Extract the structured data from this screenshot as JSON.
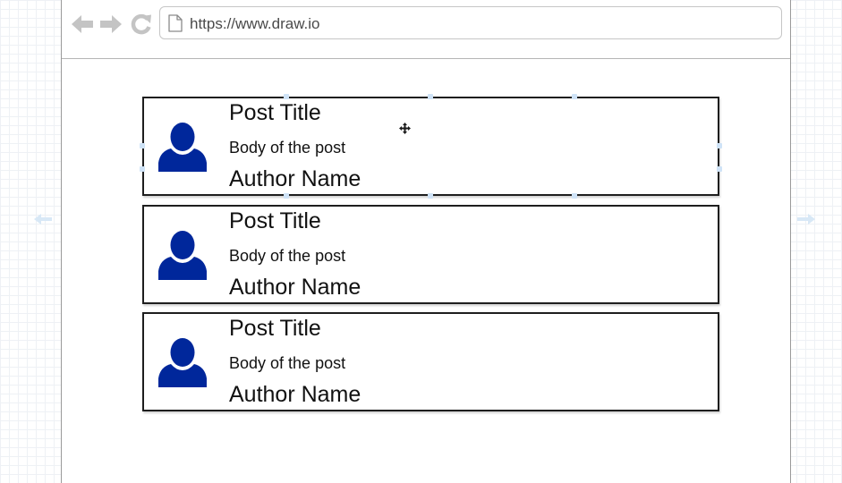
{
  "browser": {
    "url": "https://www.draw.io",
    "icons": {
      "back": "back-arrow-icon",
      "forward": "forward-arrow-icon",
      "reload": "reload-icon",
      "page": "page-icon"
    }
  },
  "posts": [
    {
      "title": "Post Title",
      "body": "Body of the post",
      "author": "Author Name",
      "icon": "user-avatar-icon"
    },
    {
      "title": "Post Title",
      "body": "Body of the post",
      "author": "Author Name",
      "icon": "user-avatar-icon"
    },
    {
      "title": "Post Title",
      "body": "Body of the post",
      "author": "Author Name",
      "icon": "user-avatar-icon"
    }
  ],
  "colors": {
    "avatar": "#00279b",
    "nav_icons": "#c4c4c4",
    "card_border": "#1e1e1e",
    "selection_handles": "#cfe3f7",
    "grid": "#eef1f5"
  }
}
